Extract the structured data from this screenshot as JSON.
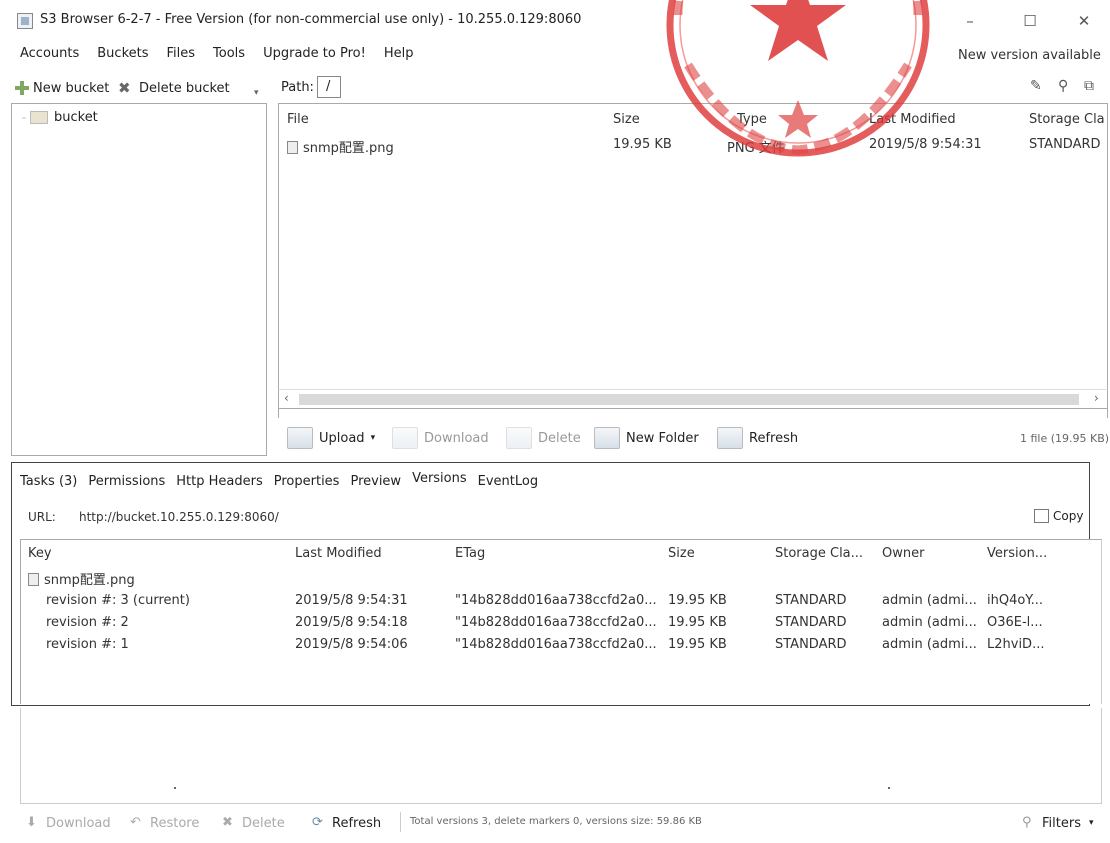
{
  "window": {
    "title": "S3 Browser 6-2-7 - Free Version (for non-commercial use only) - 10.255.0.129:8060",
    "minimize": "–",
    "maximize": "☐",
    "close": "✕"
  },
  "menu": {
    "items": [
      "Accounts",
      "Buckets",
      "Files",
      "Tools",
      "Upgrade to Pro!",
      "Help"
    ],
    "new_version": "New version available"
  },
  "left_toolbar": {
    "new_bucket": "New bucket",
    "delete_bucket": "Delete bucket"
  },
  "path": {
    "label": "Path:",
    "value": "/"
  },
  "tree": {
    "items": [
      {
        "label": "bucket"
      }
    ]
  },
  "files": {
    "columns": [
      "File",
      "Size",
      "Type",
      "Last Modified",
      "Storage Cla"
    ],
    "rows": [
      {
        "file": "snmp配置.png",
        "size": "19.95 KB",
        "type": "PNG 文件",
        "modified": "2019/5/8 9:54:31",
        "storage": "STANDARD"
      }
    ]
  },
  "file_toolbar": {
    "upload": "Upload",
    "download": "Download",
    "delete": "Delete",
    "new_folder": "New Folder",
    "refresh": "Refresh",
    "count": "1 file (19.95 KB)"
  },
  "tabs": {
    "items": [
      "Tasks (3)",
      "Permissions",
      "Http Headers",
      "Properties",
      "Preview",
      "Versions",
      "EventLog"
    ],
    "active": "Versions"
  },
  "url": {
    "label": "URL:",
    "value": "http://bucket.10.255.0.129:8060/",
    "copy": "Copy"
  },
  "versions": {
    "columns": [
      "Key",
      "Last Modified",
      "ETag",
      "Size",
      "Storage Cla...",
      "Owner",
      "Version..."
    ],
    "file": "snmp配置.png",
    "rows": [
      {
        "key": "revision #: 3 (current)",
        "modified": "2019/5/8 9:54:31",
        "etag": "\"14b828dd016aa738ccfd2a0...",
        "size": "19.95 KB",
        "storage": "STANDARD",
        "owner": "admin (admi...",
        "version": "ihQ4oY..."
      },
      {
        "key": "revision #: 2",
        "modified": "2019/5/8 9:54:18",
        "etag": "\"14b828dd016aa738ccfd2a0...",
        "size": "19.95 KB",
        "storage": "STANDARD",
        "owner": "admin (admi...",
        "version": "O36E-l..."
      },
      {
        "key": "revision #: 1",
        "modified": "2019/5/8 9:54:06",
        "etag": "\"14b828dd016aa738ccfd2a0...",
        "size": "19.95 KB",
        "storage": "STANDARD",
        "owner": "admin (admi...",
        "version": "L2hviD..."
      }
    ]
  },
  "status_bar": {
    "download": "Download",
    "restore": "Restore",
    "delete": "Delete",
    "refresh": "Refresh",
    "total": "Total versions 3, delete markers 0, versions size: 59.86 KB",
    "filters": "Filters"
  }
}
